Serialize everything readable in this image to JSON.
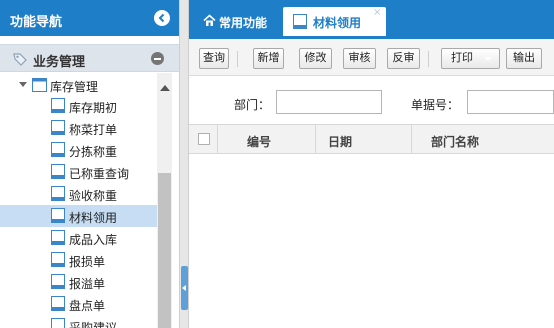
{
  "nav": {
    "title": "功能导航",
    "section_title": "业务管理",
    "tree_root": "库存管理",
    "items": [
      {
        "label": "库存期初"
      },
      {
        "label": "称菜打单"
      },
      {
        "label": "分拣称重"
      },
      {
        "label": "已称重查询"
      },
      {
        "label": "验收称重"
      },
      {
        "label": "材料领用",
        "selected": true
      },
      {
        "label": "成品入库"
      },
      {
        "label": "报损单"
      },
      {
        "label": "报溢单"
      },
      {
        "label": "盘点单"
      },
      {
        "label": "采购建议"
      }
    ]
  },
  "tabs": [
    {
      "label": "常用功能",
      "icon": "home-icon"
    },
    {
      "label": "材料领用",
      "icon": "document-icon",
      "active": true,
      "close": "×"
    }
  ],
  "toolbar": {
    "query": "查询",
    "add": "新增",
    "edit": "修改",
    "audit": "审核",
    "unaudit": "反审",
    "print": "打印",
    "export": "输出"
  },
  "filter": {
    "dept_label": "部门：",
    "dept_value": "",
    "docno_label": "单据号：",
    "docno_value": ""
  },
  "grid": {
    "columns": [
      "编号",
      "日期",
      "部门名称"
    ]
  },
  "colors": {
    "header_blue": "#1f7ec8",
    "selected_row": "#c6ddf4",
    "section_bar": "#dde4ec"
  }
}
